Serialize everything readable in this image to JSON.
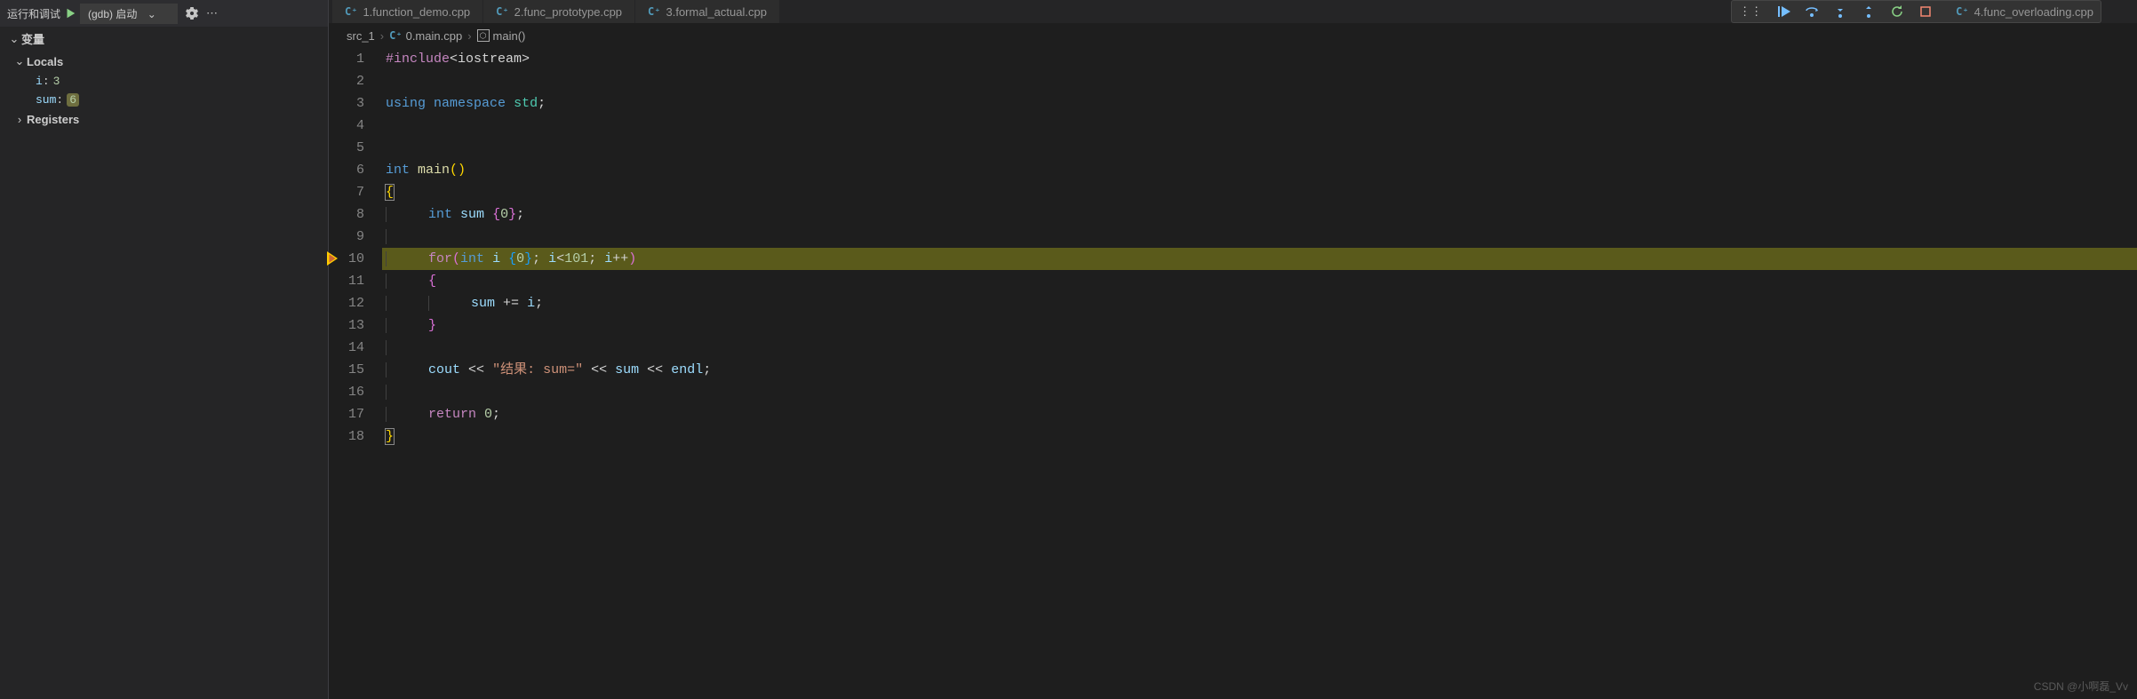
{
  "sidebar": {
    "run_debug_label": "运行和调试",
    "launch_config": "(gdb) 启动",
    "vars_header": "变量",
    "locals_header": "Locals",
    "registers_header": "Registers",
    "locals": [
      {
        "name": "i",
        "value": "3",
        "changed": false
      },
      {
        "name": "sum",
        "value": "6",
        "changed": true
      }
    ]
  },
  "tabs": [
    {
      "label": "1.function_demo.cpp"
    },
    {
      "label": "2.func_prototype.cpp"
    },
    {
      "label": "3.formal_actual.cpp"
    }
  ],
  "extra_tab": "4.func_overloading.cpp",
  "breadcrumb": {
    "root": "src_1",
    "file": "0.main.cpp",
    "symbol": "main()"
  },
  "code": {
    "lines": [
      {
        "n": 1,
        "html": "<span class='tk-pre'>#include</span><span class='tk-op'>&lt;</span><span class='tk-text'>iostream</span><span class='tk-op'>&gt;</span>"
      },
      {
        "n": 2,
        "html": ""
      },
      {
        "n": 3,
        "html": "<span class='tk-kw'>using</span> <span class='tk-kw'>namespace</span> <span class='tk-ns'>std</span><span class='tk-semi'>;</span>"
      },
      {
        "n": 4,
        "html": ""
      },
      {
        "n": 5,
        "html": ""
      },
      {
        "n": 6,
        "html": "<span class='tk-kw'>int</span> <span class='tk-fn'>main</span><span class='tk-br'>()</span>"
      },
      {
        "n": 7,
        "html": "<span class='tk-br match-br'>{</span>"
      },
      {
        "n": 8,
        "html": "<span class='indent-guide'></span><span class='tk-kw'>int</span> <span class='tk-id'>sum</span> <span class='tk-br2'>{</span><span class='tk-num'>0</span><span class='tk-br2'>}</span><span class='tk-semi'>;</span>"
      },
      {
        "n": 9,
        "html": "<span class='indent-guide-short'></span>"
      },
      {
        "n": 10,
        "html": "<span class='indent-guide'></span><span class='tk-pre'>for</span><span class='tk-br2'>(</span><span class='tk-kw'>int</span> <span class='tk-id'>i</span> <span class='tk-br3'>{</span><span class='tk-num'>0</span><span class='tk-br3'>}</span><span class='tk-semi'>;</span> <span class='tk-id'>i</span><span class='tk-op'>&lt;</span><span class='tk-num'>101</span><span class='tk-semi'>;</span> <span class='tk-id'>i</span><span class='tk-op'>++</span><span class='tk-br2'>)</span>",
        "current": true,
        "bp": true
      },
      {
        "n": 11,
        "html": "<span class='indent-guide'></span><span class='tk-br2'>{</span>"
      },
      {
        "n": 12,
        "html": "<span class='indent-guide'></span><span class='indent-guide2'></span><span class='tk-id'>sum</span> <span class='tk-op'>+=</span> <span class='tk-id'>i</span><span class='tk-semi'>;</span>"
      },
      {
        "n": 13,
        "html": "<span class='indent-guide'></span><span class='tk-br2'>}</span>"
      },
      {
        "n": 14,
        "html": "<span class='indent-guide-short'></span>"
      },
      {
        "n": 15,
        "html": "<span class='indent-guide'></span><span class='tk-id'>cout</span> <span class='tk-op'>&lt;&lt;</span> <span class='tk-str'>&quot;结果: sum=&quot;</span> <span class='tk-op'>&lt;&lt;</span> <span class='tk-id'>sum</span> <span class='tk-op'>&lt;&lt;</span> <span class='tk-id'>endl</span><span class='tk-semi'>;</span>"
      },
      {
        "n": 16,
        "html": "<span class='indent-guide-short'></span>"
      },
      {
        "n": 17,
        "html": "<span class='indent-guide'></span><span class='tk-pre'>return</span> <span class='tk-num'>0</span><span class='tk-semi'>;</span>"
      },
      {
        "n": 18,
        "html": "<span class='tk-br match-br'>}</span>"
      }
    ]
  },
  "watermark": "CSDN @小啊磊_Vv"
}
